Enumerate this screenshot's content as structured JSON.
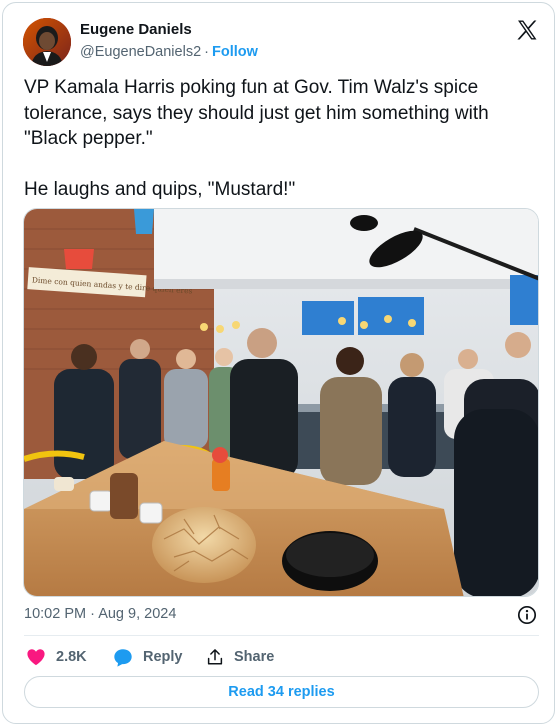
{
  "author": {
    "name": "Eugene Daniels",
    "handle": "@EugeneDaniels2",
    "separator": "·",
    "follow_label": "Follow"
  },
  "tweet": {
    "paragraph1": "VP Kamala Harris poking fun at Gov. Tim Walz's spice tolerance, says they should just get him something with \"Black pepper.\"",
    "paragraph2": "He laughs and quips, \"Mustard!\""
  },
  "media": {
    "wall_sign": "Dime con quien andas y te dire quien eres"
  },
  "meta": {
    "time": "10:02 PM",
    "separator": "·",
    "date": "Aug 9, 2024"
  },
  "actions": {
    "likes": "2.8K",
    "reply_label": "Reply",
    "share_label": "Share"
  },
  "read_replies_label": "Read 34 replies",
  "colors": {
    "accent": "#1d9bf0",
    "like": "#f91880",
    "muted": "#536471",
    "text": "#0f1419"
  },
  "icons": {
    "logo": "x-logo-icon",
    "info": "info-icon",
    "like": "heart-icon",
    "reply": "reply-bubble-icon",
    "share": "share-upload-icon"
  }
}
